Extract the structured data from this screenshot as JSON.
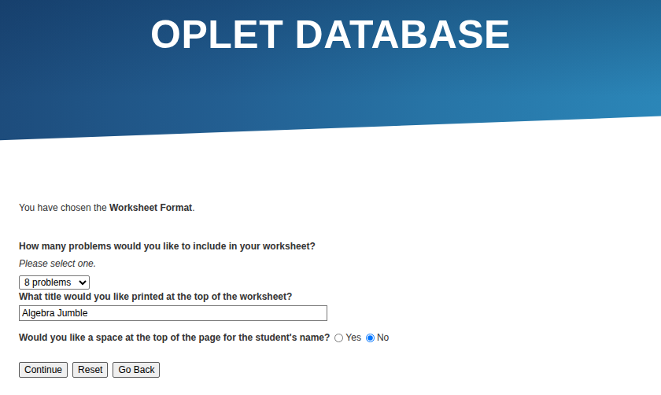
{
  "header": {
    "title": "OPLET DATABASE"
  },
  "intro": {
    "prefix": "You have chosen the ",
    "format": "Worksheet Format",
    "suffix": "."
  },
  "problem_count": {
    "label": "How many problems would you like to include in your worksheet?",
    "hint": "Please select one.",
    "value": "8 problems"
  },
  "title_field": {
    "label": "What title would you like printed at the top of the worksheet?",
    "value": "Algebra Jumble"
  },
  "name_space": {
    "label": "Would you like a space at the top of the page for the student's name?",
    "options": [
      {
        "label": "Yes",
        "selected": false
      },
      {
        "label": "No",
        "selected": true
      }
    ]
  },
  "buttons": [
    "Continue",
    "Reset",
    "Go Back"
  ]
}
